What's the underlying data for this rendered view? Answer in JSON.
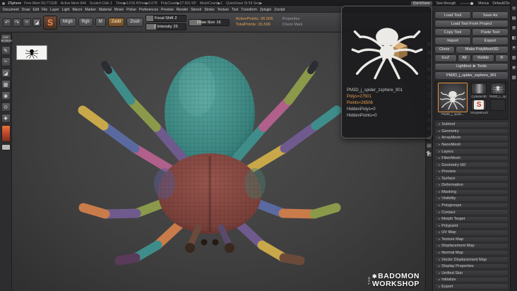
{
  "titlebar": {
    "app": "ZSphere",
    "stats": [
      "Free Mem 59.771GB",
      "Active Mem 944",
      "Scratch Disk 1",
      "Time▶0.015  ATime▶0.078",
      "PolyCount▶27.501 KP",
      "MeshCount▶1",
      "QuickSave St 59 Sec▶"
    ],
    "quicksave": "QuickSave",
    "see_through": "See-through",
    "menus": "Menus",
    "script": "DefaultZScript"
  },
  "menubar": {
    "items": [
      "Document",
      "Draw",
      "Edit",
      "File",
      "Layer",
      "Light",
      "Macro",
      "Marker",
      "Material",
      "Movie",
      "Picker",
      "Preferences",
      "Preview",
      "Render",
      "Stencil",
      "Stroke",
      "Texture",
      "Tool",
      "Transform",
      "Zplugin",
      "Zscript"
    ]
  },
  "toolbar": {
    "tiles": [
      {
        "name": "undo-icon",
        "glyph": "↶"
      },
      {
        "name": "redo-icon",
        "glyph": "↷"
      },
      {
        "name": "stroke-tile-icon",
        "glyph": "≈"
      },
      {
        "name": "alpha-tile-icon",
        "glyph": "◪"
      }
    ],
    "brush_initial": "S",
    "mrgb": "Mrgb",
    "rgb": "Rgb",
    "m": "M",
    "zadd": "Zadd",
    "zsub": "Zsub",
    "focal_shift_label": "Focal Shift",
    "focal_shift_value": "2",
    "z_intensity_label": "Z Intensity",
    "z_intensity_value": "25",
    "draw_size_label": "Draw Size",
    "draw_size_value": "16",
    "active_points": "ActivePoints: 26.506",
    "total_points": "TotalPoints: 26.506",
    "properties": "Properties",
    "check_mark": "Check Mark"
  },
  "left_dock": {
    "live_boolean": "Live Boolean",
    "icons": [
      {
        "name": "brush-icon",
        "glyph": "✎"
      },
      {
        "name": "stroke-icon",
        "glyph": "≈"
      },
      {
        "name": "alpha-icon",
        "glyph": "◪"
      },
      {
        "name": "texture-icon",
        "glyph": "▦"
      },
      {
        "name": "material-icon",
        "glyph": "◉"
      },
      {
        "name": "picker-icon",
        "glyph": "⊙"
      },
      {
        "name": "transform-icon",
        "glyph": "✚"
      }
    ]
  },
  "popup": {
    "tool_name": "PM3D_j_spider_zsphere_901",
    "polys": "Polys=27501",
    "points": "Points=26506",
    "hidden_polys": "HiddenPolys=0",
    "hidden_points": "HiddenPoints=0"
  },
  "tool_panel": {
    "load_tool": "Load Tool",
    "save_as": "Save As",
    "load_from_project": "Load Tool From Project",
    "copy_tool": "Copy Tool",
    "paste_tool": "Paste Tool",
    "import": "Import",
    "export": "Export",
    "clone": "Clone",
    "make_polymesh": "Make PolyMesh3D",
    "goz": "GoZ",
    "goz_all": "All",
    "goz_visible": "Visible",
    "goz_r": "R",
    "lightbox": "Lightbox ► Tools",
    "active_tool": "PM3D_j_spider_zsphere_901",
    "s_logo": "S",
    "section_arrow": "▸",
    "panel_arrow": "◀",
    "thumbs": [
      {
        "label": "PM3D_j_spide..."
      },
      {
        "label": "Cylinder3D"
      },
      {
        "label": "SimpleBrush"
      },
      {
        "label": "PM3D_L_spi..."
      }
    ],
    "sections": [
      "Subtool",
      "Geometry",
      "ArrayMesh",
      "NanoMesh",
      "Layers",
      "FiberMesh",
      "Geometry HD",
      "Preview",
      "Surface",
      "Deformation",
      "Masking",
      "Visibility",
      "Polygroups",
      "Contact",
      "Morph Target",
      "Polypaint",
      "UV Map",
      "Texture Map",
      "Displacement Map",
      "Normal Map",
      "Vector Displacement Map",
      "Display Properties",
      "Unified Skin",
      "Initialize",
      "Export"
    ]
  },
  "canvas": {
    "watermark_logo": "✱",
    "watermark_side": "THE",
    "watermark_line1": "BADOMON",
    "watermark_line2": "WORKSHOP"
  },
  "shelf": {
    "icons": [
      {
        "name": "bpr-icon",
        "glyph": "▣"
      },
      {
        "name": "render-mode-icon",
        "glyph": "◨"
      },
      {
        "name": "persp-icon",
        "glyph": "△"
      },
      {
        "name": "floor-icon",
        "glyph": "▦"
      },
      {
        "name": "local-icon",
        "glyph": "⊕"
      },
      {
        "name": "lsym-icon",
        "glyph": "◐"
      },
      {
        "name": "transp-icon",
        "glyph": "◻"
      },
      {
        "name": "ghost-icon",
        "glyph": "◌"
      },
      {
        "name": "solo-icon",
        "glyph": "◉"
      },
      {
        "name": "xpose-icon",
        "glyph": "⇅"
      },
      {
        "name": "scroll-icon",
        "glyph": "⇄"
      },
      {
        "name": "zoom-icon",
        "glyph": "⊙"
      },
      {
        "name": "actual-size-icon",
        "glyph": "▭"
      },
      {
        "name": "aa-half-icon",
        "glyph": "◩"
      }
    ]
  },
  "right_strip": {
    "icons": [
      {
        "name": "menu-handle-icon",
        "glyph": "≡"
      },
      {
        "name": "divider-icon",
        "glyph": "▤"
      },
      {
        "name": "settings-icon",
        "glyph": "⚙"
      },
      {
        "name": "dock-icon",
        "glyph": "◧"
      },
      {
        "name": "star-icon",
        "glyph": "✦"
      },
      {
        "name": "grid-icon",
        "glyph": "▥"
      },
      {
        "name": "diamond-icon",
        "glyph": "◈"
      },
      {
        "name": "shade-icon",
        "glyph": "▧"
      }
    ]
  },
  "model_colors": {
    "abdomen_teal": "#3a837e",
    "cephalothorax_red": "#7a403a",
    "leg_palette": [
      "#6f5a8e",
      "#8a9a4a",
      "#3f8d8a",
      "#b0608a",
      "#5a6aa0",
      "#c9a84a",
      "#c97b4a",
      "#5a3a5a",
      "#6b4a3a"
    ]
  }
}
